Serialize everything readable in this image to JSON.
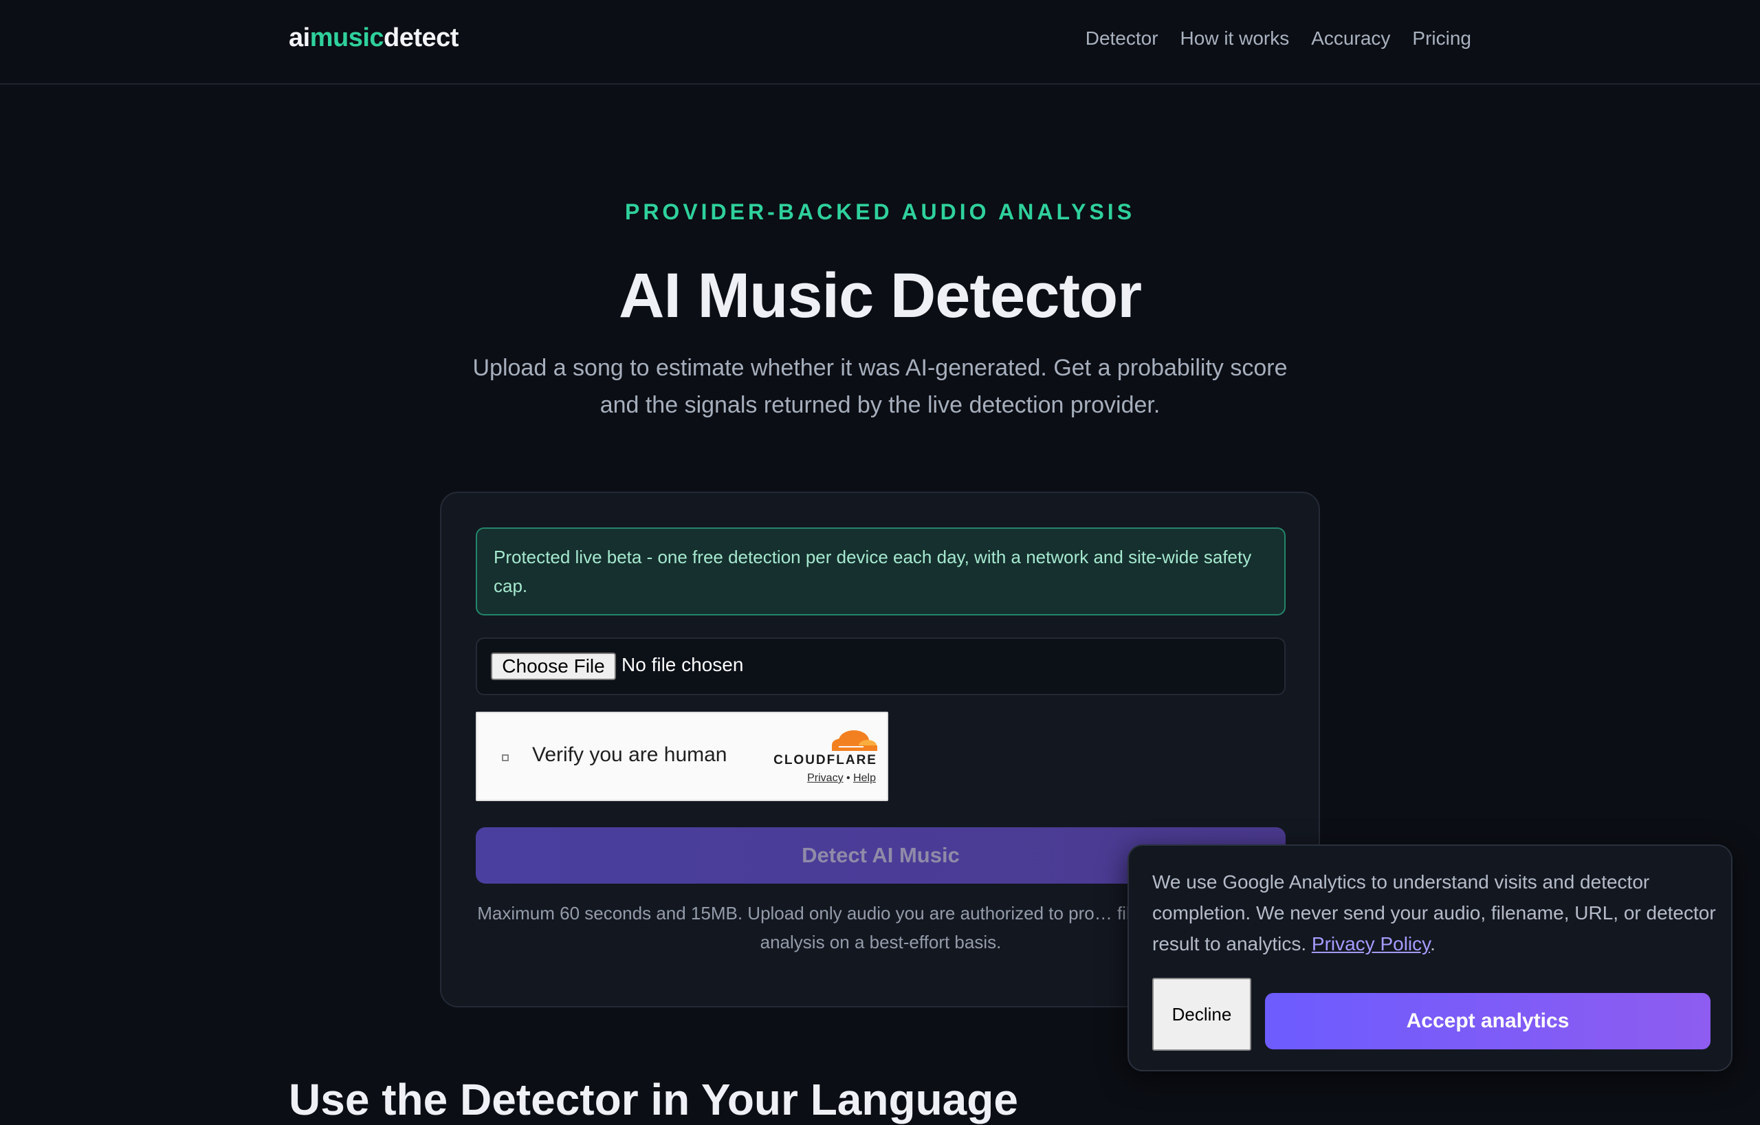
{
  "header": {
    "logo": {
      "part1": "ai",
      "part2": "music",
      "part3": "detect"
    },
    "nav": [
      "Detector",
      "How it works",
      "Accuracy",
      "Pricing"
    ]
  },
  "hero": {
    "eyebrow": "PROVIDER-BACKED AUDIO ANALYSIS",
    "title": "AI Music Detector",
    "subtitle": "Upload a song to estimate whether it was AI-generated. Get a probability score and the signals returned by the live detection provider."
  },
  "detector": {
    "notice": "Protected live beta - one free detection per device each day, with a network and site-wide safety cap.",
    "file_button": "Choose File",
    "file_status": "No file chosen",
    "captcha": {
      "label": "Verify you are human",
      "brand": "CLOUDFLARE",
      "privacy": "Privacy",
      "separator": "•",
      "help": "Help"
    },
    "detect_button": "Detect AI Music",
    "fineprint": "Maximum 60 seconds and 15MB. Upload only audio you are authorized to pro… files are deleted after analysis on a best-effort basis."
  },
  "next_section": {
    "heading": "Use the Detector in Your Language"
  },
  "cookie": {
    "text": "We use Google Analytics to understand visits and detector completion. We never send your audio, filename, URL, or detector result to analytics.",
    "privacy_link": "Privacy Policy",
    "period": ".",
    "decline": "Decline",
    "accept": "Accept analytics"
  },
  "colors": {
    "background": "#0b0e14",
    "accent_green": "#2fd19c",
    "accent_purple": "#6d5cff",
    "card": "#131720"
  },
  "icons": [
    "cloudflare-logo-icon",
    "checkbox-icon"
  ]
}
